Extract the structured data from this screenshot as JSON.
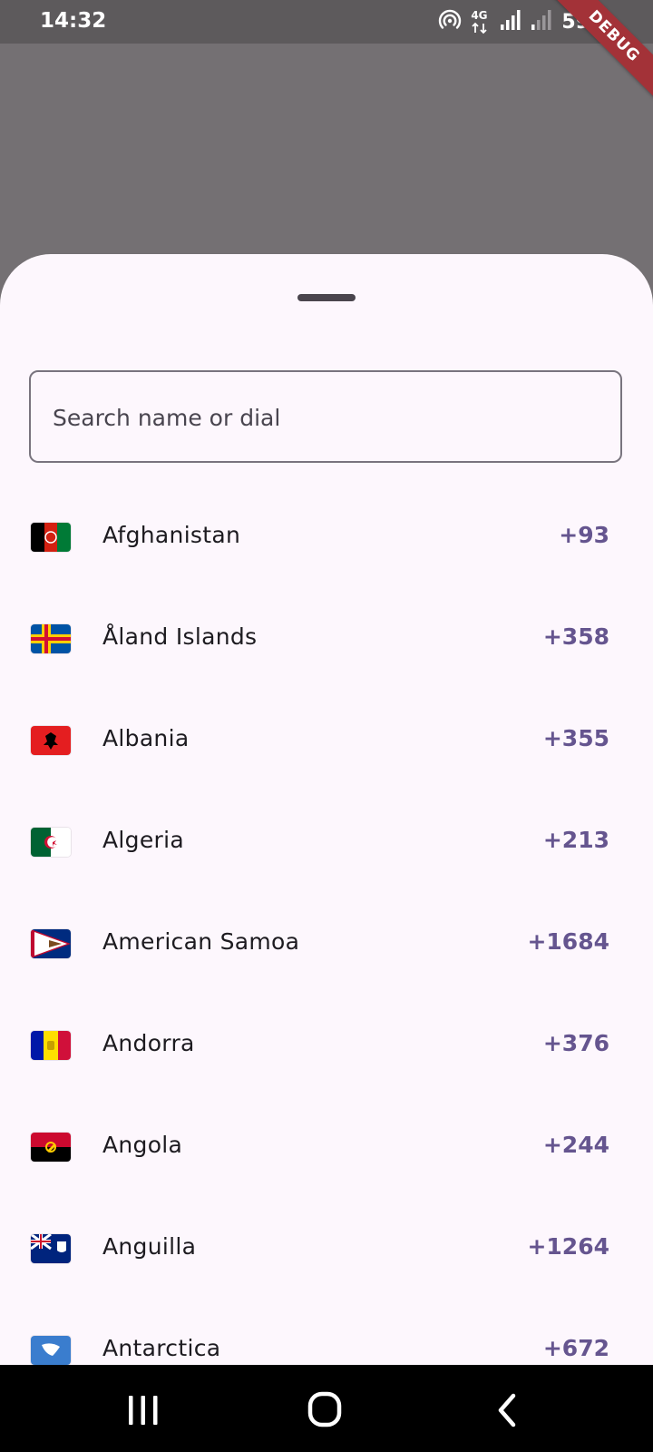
{
  "status_bar": {
    "time": "14:32",
    "network": "4G",
    "battery": "59%",
    "icons": [
      "hotspot-icon",
      "4g-icon",
      "signal-icon",
      "signal-weak-icon",
      "battery-charging-icon"
    ]
  },
  "debug_banner": "DEBUG",
  "search": {
    "placeholder": "Search name or dial",
    "value": ""
  },
  "countries": [
    {
      "name": "Afghanistan",
      "dial": "+93"
    },
    {
      "name": "Åland Islands",
      "dial": "+358"
    },
    {
      "name": "Albania",
      "dial": "+355"
    },
    {
      "name": "Algeria",
      "dial": "+213"
    },
    {
      "name": "American Samoa",
      "dial": "+1684"
    },
    {
      "name": "Andorra",
      "dial": "+376"
    },
    {
      "name": "Angola",
      "dial": "+244"
    },
    {
      "name": "Anguilla",
      "dial": "+1264"
    },
    {
      "name": "Antarctica",
      "dial": "+672"
    }
  ],
  "colors": {
    "scrim": "#747073",
    "sheet_background": "#fdf7fd",
    "dial_code": "#65558f",
    "debug_banner": "#a33238"
  },
  "nav_bar": {
    "icons": [
      "recents-icon",
      "home-icon",
      "back-icon"
    ]
  }
}
